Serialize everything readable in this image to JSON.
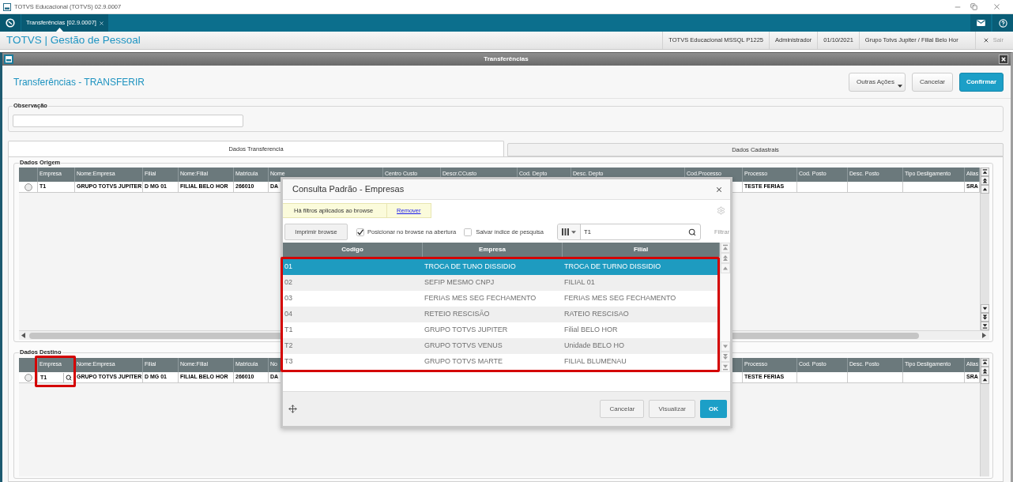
{
  "app_window": {
    "title": "TOTVS Educacional (TOTVS) 02.9.0007"
  },
  "tab_bar": {
    "tabs": [
      {
        "label": "Transferências [02.9.0007]",
        "selected": true
      }
    ]
  },
  "header": {
    "title": "TOTVS | Gestão de Pessoal",
    "info": [
      "TOTVS Educacional MSSQL P1225",
      "Administrador",
      "01/10/2021",
      "Grupo Totvs Jupiter / Filial Belo Hor"
    ],
    "exit_button": {
      "label": "Sair",
      "disabled": true
    }
  },
  "form": {
    "window_title": "Transferências",
    "heading": "Transferências - TRANSFERIR",
    "buttons": [
      {
        "label": "Outras Ações",
        "kind": "menu"
      },
      {
        "label": "Cancelar",
        "kind": "default"
      },
      {
        "label": "Confirmar",
        "kind": "primary"
      }
    ],
    "observacao": {
      "label": "Observação"
    },
    "tabs": [
      {
        "label": "Dados Transferencia",
        "selected": true
      },
      {
        "label": "Dados Cadastrais",
        "selected": false
      }
    ],
    "dados_origem": {
      "title": "Dados Origem",
      "row_selected": false,
      "columns": [
        {
          "header": "Empresa",
          "value": "T1",
          "kind": "text"
        },
        {
          "header": "Nome:Empresa",
          "value": "GRUPO TOTVS JUPITER",
          "kind": "text"
        },
        {
          "header": "Filial",
          "value": "D MG 01",
          "kind": "text"
        },
        {
          "header": "Nome:Filial",
          "value": "FILIAL BELO HOR",
          "kind": "text"
        },
        {
          "header": "Matricula",
          "value": "266010",
          "kind": "text"
        },
        {
          "header": "Nome",
          "value": "DA",
          "kind": "text"
        },
        {
          "header": "Centro Custo",
          "kind": "text"
        },
        {
          "header": "Descr.CCusto",
          "kind": "text"
        },
        {
          "header": "Cod. Depto",
          "kind": "text"
        },
        {
          "header": "Desc. Depto",
          "kind": "text"
        },
        {
          "header": "Cod.Processo",
          "kind": "text"
        },
        {
          "header": "Processo",
          "value": "TESTE FERIAS",
          "kind": "text"
        },
        {
          "header": "Cod. Posto",
          "kind": "text"
        },
        {
          "header": "Desc. Posto",
          "kind": "text"
        },
        {
          "header": "Tipo Desligamento",
          "kind": "text"
        },
        {
          "header": "Alias",
          "value": "SRA",
          "kind": "text"
        }
      ]
    },
    "dados_destino": {
      "title": "Dados Destino",
      "row_selected": false,
      "columns": [
        {
          "header": "Empresa",
          "value": "T1",
          "kind": "lookup",
          "highlighted": true
        },
        {
          "header": "Nome:Empresa",
          "value": "GRUPO TOTVS JUPITER",
          "kind": "text",
          "highlighted": false
        },
        {
          "header": "Filial",
          "value": "D MG 01",
          "kind": "text",
          "highlighted": false
        },
        {
          "header": "Nome:Filial",
          "value": "FILIAL BELO HOR",
          "kind": "text",
          "highlighted": false
        },
        {
          "header": "Matricula",
          "value": "266010",
          "kind": "text",
          "highlighted": false
        },
        {
          "header": "No",
          "value": "DA",
          "kind": "text",
          "highlighted": false
        }
      ],
      "trailing_columns": [
        {
          "header": "Processo",
          "value": "TESTE FERIAS",
          "kind": "text",
          "highlighted": false
        },
        {
          "header": "Cod. Posto",
          "kind": "text",
          "highlighted": false
        },
        {
          "header": "Desc. Posto",
          "kind": "text",
          "highlighted": false
        },
        {
          "header": "Tipo Desligamento",
          "kind": "text",
          "highlighted": false
        },
        {
          "header": "Alias",
          "value": "SRA",
          "kind": "text",
          "highlighted": false
        }
      ]
    }
  },
  "dialog": {
    "title": "Consulta Padrão - Empresas",
    "filter_notice": "Há filtros aplicados ao browse",
    "remove_link": "Remover",
    "print_button": "Imprimir browse",
    "options": [
      {
        "label": "Posicionar no browse na abertura",
        "checked": true
      },
      {
        "label": "Salvar índice de pesquisa",
        "checked": false
      }
    ],
    "search": {
      "value": "T1"
    },
    "filter_button": {
      "label": "Filtrar",
      "disabled": true
    },
    "table": {
      "highlighted": true,
      "columns": [
        "Codigo",
        "Empresa",
        "Filial"
      ],
      "rows": [
        {
          "selected": true,
          "cells": [
            "01",
            "TROCA DE TUNO DISSIDIO",
            "TROCA DE TURNO DISSIDIO"
          ]
        },
        {
          "selected": false,
          "cells": [
            "02",
            "SEFIP MESMO CNPJ",
            "FILIAL 01"
          ]
        },
        {
          "selected": false,
          "cells": [
            "03",
            "FERIAS MES SEG FECHAMENTO",
            "FERIAS MES SEG FECHAMENTO"
          ]
        },
        {
          "selected": false,
          "cells": [
            "04",
            "RETEIO RESCISÃO",
            "RATEIO RESCISAO"
          ]
        },
        {
          "selected": false,
          "cells": [
            "T1",
            "GRUPO TOTVS JUPITER",
            "Filial BELO HOR"
          ]
        },
        {
          "selected": false,
          "cells": [
            "T2",
            "GRUPO TOTVS VENUS",
            "Unidade BELO HO"
          ]
        },
        {
          "selected": false,
          "cells": [
            "T3",
            "GRUPO TOTVS MARTE",
            "FILIAL BLUMENAU"
          ]
        }
      ]
    },
    "buttons": [
      {
        "label": "Cancelar",
        "kind": "default"
      },
      {
        "label": "Visualizar",
        "kind": "default"
      },
      {
        "label": "OK",
        "kind": "primary"
      }
    ]
  }
}
